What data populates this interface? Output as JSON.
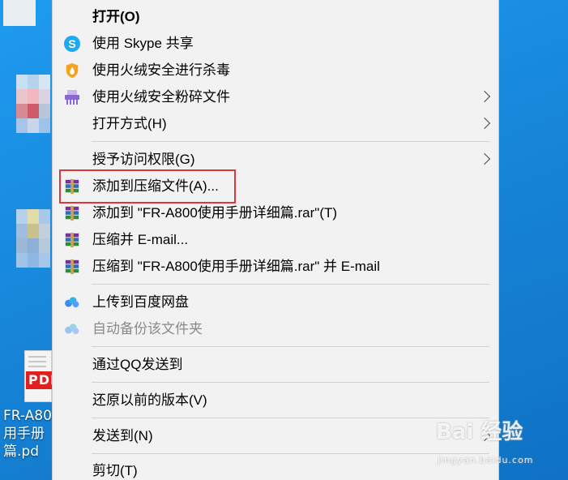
{
  "menu": {
    "items": [
      {
        "label": "打开(O)"
      },
      {
        "label": "使用 Skype 共享"
      },
      {
        "label": "使用火绒安全进行杀毒"
      },
      {
        "label": "使用火绒安全粉碎文件"
      },
      {
        "label": "打开方式(H)"
      },
      {
        "label": "授予访问权限(G)"
      },
      {
        "label": "添加到压缩文件(A)..."
      },
      {
        "label": "添加到 \"FR-A800使用手册详细篇.rar\"(T)"
      },
      {
        "label": "压缩并 E-mail..."
      },
      {
        "label": "压缩到 \"FR-A800使用手册详细篇.rar\" 并 E-mail"
      },
      {
        "label": "上传到百度网盘"
      },
      {
        "label": "自动备份该文件夹"
      },
      {
        "label": "通过QQ发送到"
      },
      {
        "label": "还原以前的版本(V)"
      },
      {
        "label": "发送到(N)"
      },
      {
        "label": "剪切(T)"
      }
    ]
  },
  "desktop": {
    "file_icon_badge": "PDF",
    "file_label_lines": [
      "FR-A80",
      "用手册",
      "篇.pd"
    ]
  },
  "watermark": {
    "brand": "Bai  经验",
    "url": "jingyan.baidu.com"
  },
  "colors": {
    "desktop_bg": "#1683d6",
    "menu_bg": "#f2f2f2",
    "highlight_border": "#e0353b",
    "skype_blue": "#1eaaf1"
  }
}
